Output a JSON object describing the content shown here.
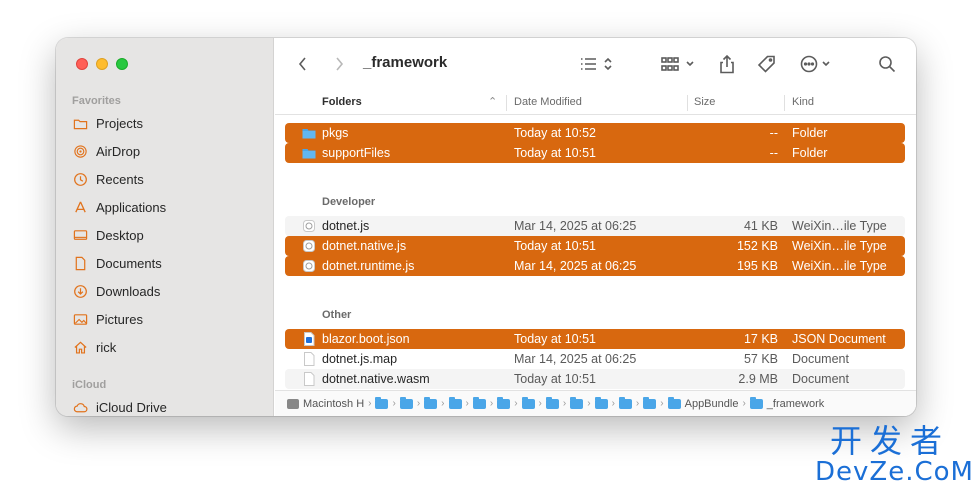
{
  "window": {
    "title": "_framework"
  },
  "sidebar": {
    "favorites_label": "Favorites",
    "icloud_label": "iCloud",
    "items": [
      {
        "label": "Projects",
        "icon": "folder-icon"
      },
      {
        "label": "AirDrop",
        "icon": "airdrop-icon"
      },
      {
        "label": "Recents",
        "icon": "clock-icon"
      },
      {
        "label": "Applications",
        "icon": "applications-icon"
      },
      {
        "label": "Desktop",
        "icon": "desktop-icon"
      },
      {
        "label": "Documents",
        "icon": "document-icon"
      },
      {
        "label": "Downloads",
        "icon": "download-icon"
      },
      {
        "label": "Pictures",
        "icon": "pictures-icon"
      },
      {
        "label": "rick",
        "icon": "home-icon"
      }
    ],
    "icloud_items": [
      {
        "label": "iCloud Drive",
        "icon": "cloud-icon"
      }
    ]
  },
  "columns": {
    "name": "Folders",
    "date": "Date Modified",
    "size": "Size",
    "kind": "Kind"
  },
  "groups": {
    "developer": "Developer",
    "other": "Other"
  },
  "folders": [
    {
      "name": "pkgs",
      "date": "Today at 10:52",
      "size": "--",
      "kind": "Folder",
      "selected": true
    },
    {
      "name": "supportFiles",
      "date": "Today at 10:51",
      "size": "--",
      "kind": "Folder",
      "selected": true
    }
  ],
  "developer": [
    {
      "name": "dotnet.js",
      "date": "Mar 14, 2025 at 06:25",
      "size": "41 KB",
      "kind": "WeiXin…ile Type",
      "selected": false
    },
    {
      "name": "dotnet.native.js",
      "date": "Today at 10:51",
      "size": "152 KB",
      "kind": "WeiXin…ile Type",
      "selected": true
    },
    {
      "name": "dotnet.runtime.js",
      "date": "Mar 14, 2025 at 06:25",
      "size": "195 KB",
      "kind": "WeiXin…ile Type",
      "selected": true
    }
  ],
  "other": [
    {
      "name": "blazor.boot.json",
      "date": "Today at 10:51",
      "size": "17 KB",
      "kind": "JSON Document",
      "selected": true
    },
    {
      "name": "dotnet.js.map",
      "date": "Mar 14, 2025 at 06:25",
      "size": "57 KB",
      "kind": "Document",
      "selected": false
    },
    {
      "name": "dotnet.native.wasm",
      "date": "Today at 10:51",
      "size": "2.9 MB",
      "kind": "Document",
      "selected": false
    }
  ],
  "pathbar": {
    "root": "Macintosh H",
    "bundle": "AppBundle",
    "current": "_framework"
  },
  "watermark": {
    "cn": "开发者",
    "en": "DevZe.CoM"
  },
  "colors": {
    "accent": "#d8680f",
    "folder": "#4aa6e8"
  }
}
